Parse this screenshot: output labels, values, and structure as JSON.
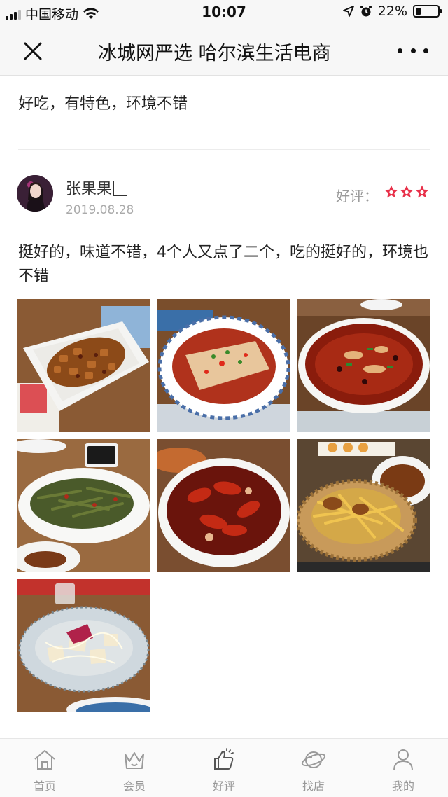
{
  "status_bar": {
    "carrier": "中国移动",
    "time": "10:07",
    "battery_percent": "22%",
    "battery_level": 0.22
  },
  "nav": {
    "title": "冰城网严选 哈尔滨生活电商"
  },
  "previous_review": {
    "text": "好吃，有特色，环境不错"
  },
  "review": {
    "username": "张果果",
    "date": "2019.08.28",
    "rating_label": "好评：",
    "rating_stars": 3,
    "text": "挺好的，味道不错，4个人又点了二个，吃的挺好的，环境也不错",
    "photos": [
      {
        "icon": "kung-pao-chicken-photo"
      },
      {
        "icon": "cold-noodle-chili-photo"
      },
      {
        "icon": "boiled-fish-photo"
      },
      {
        "icon": "fried-green-beans-photo"
      },
      {
        "icon": "spicy-crayfish-photo"
      },
      {
        "icon": "fries-basket-photo"
      },
      {
        "icon": "tofu-salad-photo"
      }
    ]
  },
  "tab_bar": {
    "tabs": [
      {
        "label": "首页",
        "icon": "home-icon"
      },
      {
        "label": "会员",
        "icon": "crown-icon"
      },
      {
        "label": "好评",
        "icon": "thumbs-up-icon"
      },
      {
        "label": "找店",
        "icon": "planet-icon"
      },
      {
        "label": "我的",
        "icon": "person-icon"
      }
    ]
  },
  "colors": {
    "star": "#e8314a",
    "text": "#222222",
    "muted": "#aaaaaa"
  }
}
